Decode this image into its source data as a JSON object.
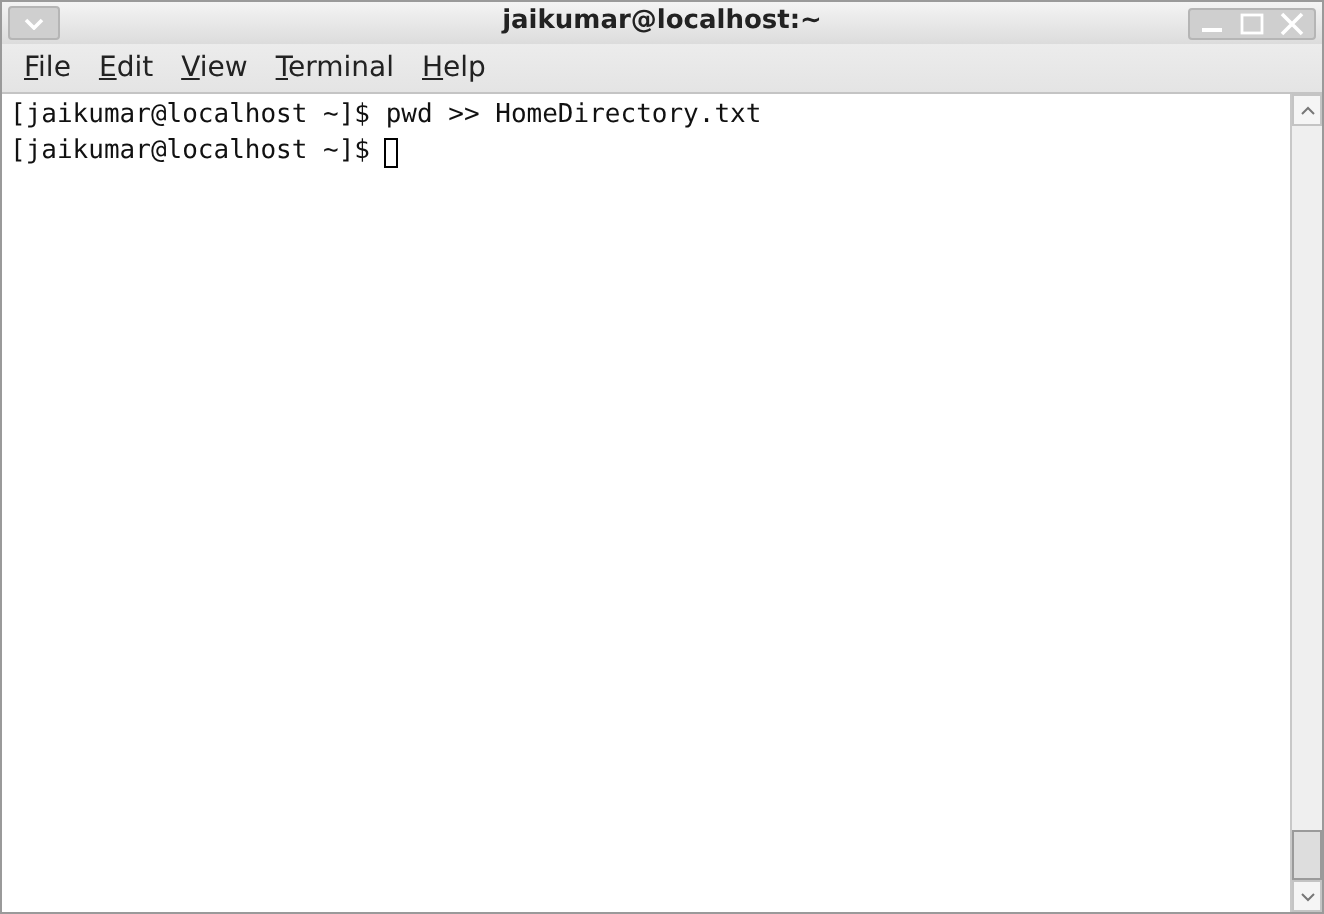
{
  "window": {
    "title": "jaikumar@localhost:~"
  },
  "menu": [
    {
      "label": "File"
    },
    {
      "label": "Edit"
    },
    {
      "label": "View"
    },
    {
      "label": "Terminal"
    },
    {
      "label": "Help"
    }
  ],
  "terminal": {
    "lines": [
      {
        "prompt": "[jaikumar@localhost ~]$",
        "command": "pwd >> HomeDirectory.txt",
        "cursor": false
      },
      {
        "prompt": "[jaikumar@localhost ~]$",
        "cursor": true
      }
    ]
  }
}
